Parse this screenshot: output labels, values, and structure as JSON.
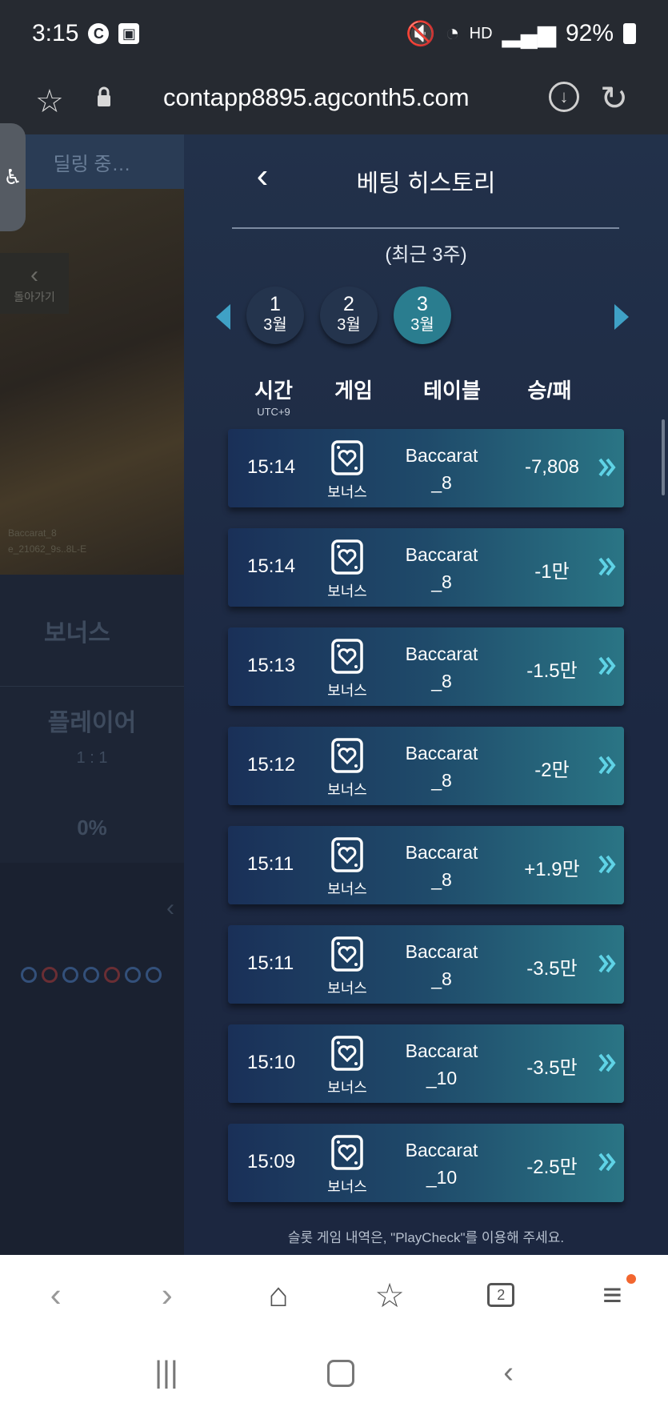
{
  "status_bar": {
    "time": "3:15",
    "notif_icons": [
      "C",
      "image-icon"
    ],
    "hd_label": "HD",
    "voice_label": "Voice",
    "battery": "92%"
  },
  "url_bar": {
    "url": "contapp8895.agconth5.com"
  },
  "background_game": {
    "dealing": "딜링 중…",
    "back_label": "돌아가기",
    "table_info_1": "Baccarat_8",
    "table_info_2": "e_21062_9s..8L-E",
    "bonus": "보너스",
    "player": "플레이어",
    "ratio": "1 : 1",
    "percent": "0%"
  },
  "panel": {
    "title": "베팅 히스토리",
    "subtitle": "(최근 3주)",
    "weeks": [
      {
        "num": "1",
        "month": "3월",
        "active": false
      },
      {
        "num": "2",
        "month": "3월",
        "active": false
      },
      {
        "num": "3",
        "month": "3월",
        "active": true
      }
    ],
    "headers": {
      "time": "시간",
      "time_sub": "UTC+9",
      "game": "게임",
      "table": "테이블",
      "result": "승/패"
    },
    "rows": [
      {
        "time": "15:14",
        "game": "보너스",
        "table1": "Baccarat",
        "table2": "_8",
        "result": "-7,808"
      },
      {
        "time": "15:14",
        "game": "보너스",
        "table1": "Baccarat",
        "table2": "_8",
        "result": "-1만"
      },
      {
        "time": "15:13",
        "game": "보너스",
        "table1": "Baccarat",
        "table2": "_8",
        "result": "-1.5만"
      },
      {
        "time": "15:12",
        "game": "보너스",
        "table1": "Baccarat",
        "table2": "_8",
        "result": "-2만"
      },
      {
        "time": "15:11",
        "game": "보너스",
        "table1": "Baccarat",
        "table2": "_8",
        "result": "+1.9만"
      },
      {
        "time": "15:11",
        "game": "보너스",
        "table1": "Baccarat",
        "table2": "_8",
        "result": "-3.5만"
      },
      {
        "time": "15:10",
        "game": "보너스",
        "table1": "Baccarat",
        "table2": "_10",
        "result": "-3.5만"
      },
      {
        "time": "15:09",
        "game": "보너스",
        "table1": "Baccarat",
        "table2": "_10",
        "result": "-2.5만"
      }
    ],
    "footer": "슬롯 게임 내역은, \"PlayCheck\"를 이용해 주세요."
  },
  "nav": {
    "tabs_count": "2"
  },
  "colors": {
    "accent": "#3fa1c6",
    "active_week": "#2a7d8f",
    "panel_bg": "#1c2842",
    "badge": "#f2662f"
  }
}
